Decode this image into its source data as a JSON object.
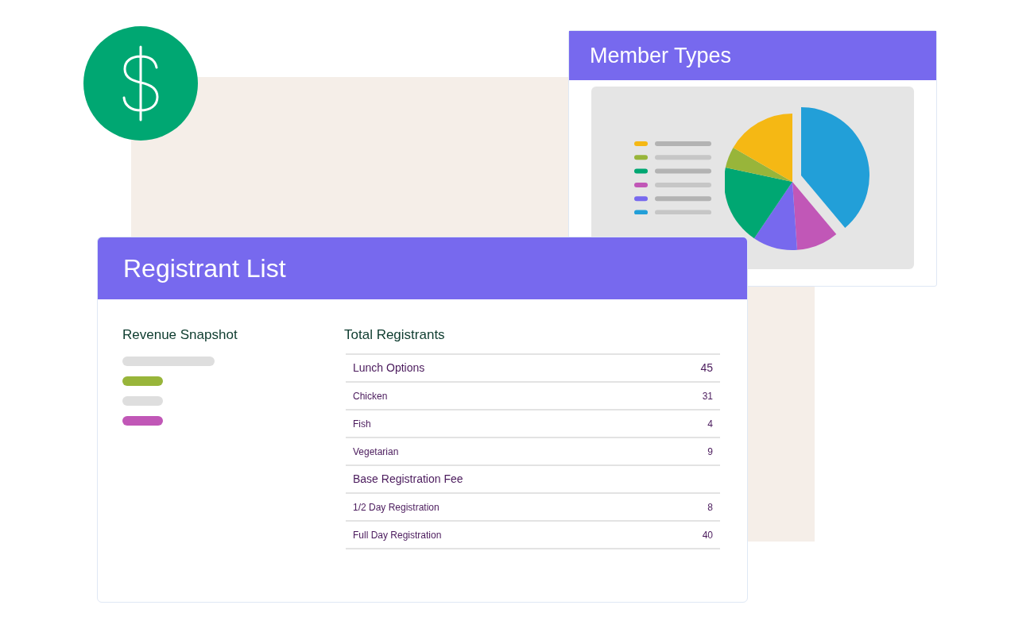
{
  "member_types_card": {
    "title": "Member Types"
  },
  "registrant_card": {
    "title": "Registrant List",
    "revenue_snapshot": {
      "title": "Revenue Snapshot"
    },
    "table": {
      "title": "Total Registrants",
      "groups": [
        {
          "name": "Lunch Options",
          "total": "45",
          "rows": [
            {
              "label": "Chicken",
              "value": "31"
            },
            {
              "label": "Fish",
              "value": "4"
            },
            {
              "label": "Vegetarian",
              "value": "9"
            }
          ]
        },
        {
          "name": "Base Registration Fee",
          "rows": [
            {
              "label": "1/2 Day Registration",
              "value": "8"
            },
            {
              "label": "Full Day Registration",
              "value": "40"
            }
          ]
        }
      ]
    }
  }
}
